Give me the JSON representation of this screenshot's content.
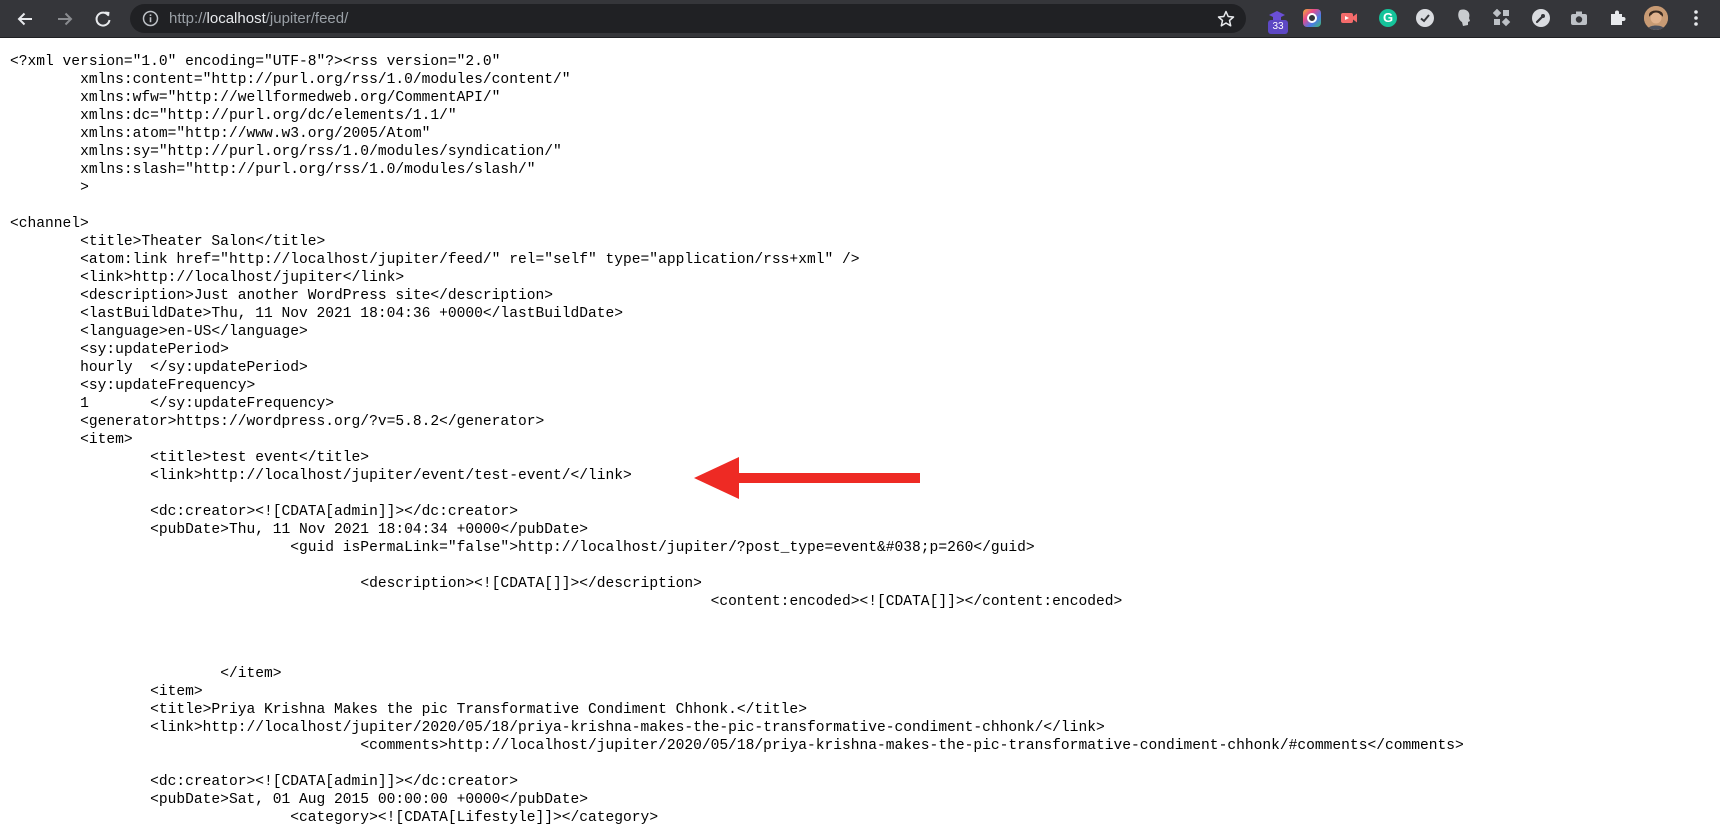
{
  "browser": {
    "url_prefix": "http://",
    "url_host": "localhost",
    "url_path": "/jupiter/feed/",
    "extension_badge": "33",
    "icons": [
      "back-arrow-icon",
      "forward-arrow-icon",
      "reload-icon",
      "info-icon",
      "star-icon",
      "puzzle-piece-icon",
      "kebab-menu-icon"
    ]
  },
  "document": {
    "text": "<?xml version=\"1.0\" encoding=\"UTF-8\"?><rss version=\"2.0\"\n\txmlns:content=\"http://purl.org/rss/1.0/modules/content/\"\n\txmlns:wfw=\"http://wellformedweb.org/CommentAPI/\"\n\txmlns:dc=\"http://purl.org/dc/elements/1.1/\"\n\txmlns:atom=\"http://www.w3.org/2005/Atom\"\n\txmlns:sy=\"http://purl.org/rss/1.0/modules/syndication/\"\n\txmlns:slash=\"http://purl.org/rss/1.0/modules/slash/\"\n\t>\n\n<channel>\n\t<title>Theater Salon</title>\n\t<atom:link href=\"http://localhost/jupiter/feed/\" rel=\"self\" type=\"application/rss+xml\" />\n\t<link>http://localhost/jupiter</link>\n\t<description>Just another WordPress site</description>\n\t<lastBuildDate>Thu, 11 Nov 2021 18:04:36 +0000</lastBuildDate>\n\t<language>en-US</language>\n\t<sy:updatePeriod>\n\thourly\t</sy:updatePeriod>\n\t<sy:updateFrequency>\n\t1\t</sy:updateFrequency>\n\t<generator>https://wordpress.org/?v=5.8.2</generator>\n\t<item>\n\t\t<title>test event</title>\n\t\t<link>http://localhost/jupiter/event/test-event/</link>\n\n\t\t<dc:creator><![CDATA[admin]]></dc:creator>\n\t\t<pubDate>Thu, 11 Nov 2021 18:04:34 +0000</pubDate>\n\t\t\t\t<guid isPermaLink=\"false\">http://localhost/jupiter/?post_type=event&#038;p=260</guid>\n\n\t\t\t\t\t<description><![CDATA[]]></description>\n\t\t\t\t\t\t\t\t\t\t<content:encoded><![CDATA[]]></content:encoded>\n\n\n\n\t\t\t</item>\n\t\t<item>\n\t\t<title>Priya Krishna Makes the pic Transformative Condiment Chhonk.</title>\n\t\t<link>http://localhost/jupiter/2020/05/18/priya-krishna-makes-the-pic-transformative-condiment-chhonk/</link>\n\t\t\t\t\t<comments>http://localhost/jupiter/2020/05/18/priya-krishna-makes-the-pic-transformative-condiment-chhonk/#comments</comments>\n\n\t\t<dc:creator><![CDATA[admin]]></dc:creator>\n\t\t<pubDate>Sat, 01 Aug 2015 00:00:00 +0000</pubDate>\n\t\t\t\t<category><![CDATA[Lifestyle]]></category>"
  },
  "annotation": {
    "arrow_color": "#ee2a24"
  }
}
